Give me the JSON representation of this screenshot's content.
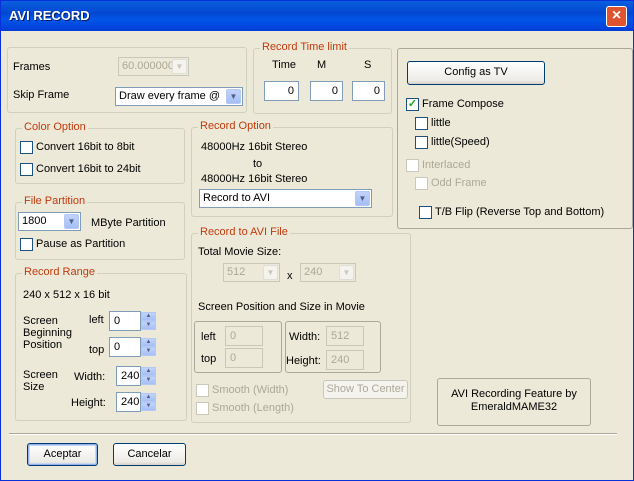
{
  "window": {
    "title": "AVI RECORD",
    "close": "×"
  },
  "frames": {
    "label": "Frames",
    "value": "60.000000"
  },
  "skip_frame": {
    "label": "Skip Frame",
    "value": "Draw every frame  @"
  },
  "record_time_limit": {
    "title": "Record Time limit",
    "time_label": "Time",
    "m_label": "M",
    "s_label": "S",
    "time_value": "0",
    "m_value": "0",
    "s_value": "0"
  },
  "color_option": {
    "title": "Color Option",
    "opt1": "Convert 16bit to 8bit",
    "opt2": "Convert 16bit to 24bit"
  },
  "file_partition": {
    "title": "File Partition",
    "value": "1800",
    "unit": "MByte Partition",
    "pause": "Pause as Partition"
  },
  "record_range": {
    "title": "Record Range",
    "info": "240 x 512 x 16 bit",
    "screen_beginning_position": "Screen\nBeginning\nPosition",
    "left_label": "left",
    "left_value": "0",
    "top_label": "top",
    "top_value": "0",
    "screen_size": "Screen\nSize",
    "width_label": "Width:",
    "width_value": "240",
    "height_label": "Height:",
    "height_value": "240"
  },
  "record_option": {
    "title": "Record Option",
    "line1": "48000Hz 16bit Stereo",
    "line2": "to",
    "line3": "48000Hz 16bit Stereo",
    "mode": "Record to AVI"
  },
  "record_to_avi": {
    "title": "Record to AVI File",
    "total_movie_size": "Total Movie Size:",
    "size_w": "512",
    "x": "x",
    "size_h": "240",
    "screen_pos_title": "Screen Position and Size in Movie",
    "left_label": "left",
    "left_value": "0",
    "top_label": "top",
    "top_value": "0",
    "width_label": "Width:",
    "width_value": "512",
    "height_label": "Height:",
    "height_value": "240",
    "smooth_width": "Smooth (Width)",
    "smooth_length": "Smooth (Length)",
    "show_to_center": "Show To Center"
  },
  "right_panel": {
    "config_tv": "Config as TV",
    "frame_compose": "Frame Compose",
    "little": "little",
    "little_speed": "little(Speed)",
    "interlaced": "Interlaced",
    "odd_frame": "Odd Frame",
    "tb_flip": "T/B Flip (Reverse Top and Bottom)"
  },
  "credit": {
    "line1": "AVI Recording Feature by",
    "line2": "EmeraldMAME32"
  },
  "footer": {
    "ok": "Aceptar",
    "cancel": "Cancelar"
  },
  "checkmark": "✓",
  "colors": {
    "accent": "#0347d1",
    "group_label": "#c33a0d"
  }
}
